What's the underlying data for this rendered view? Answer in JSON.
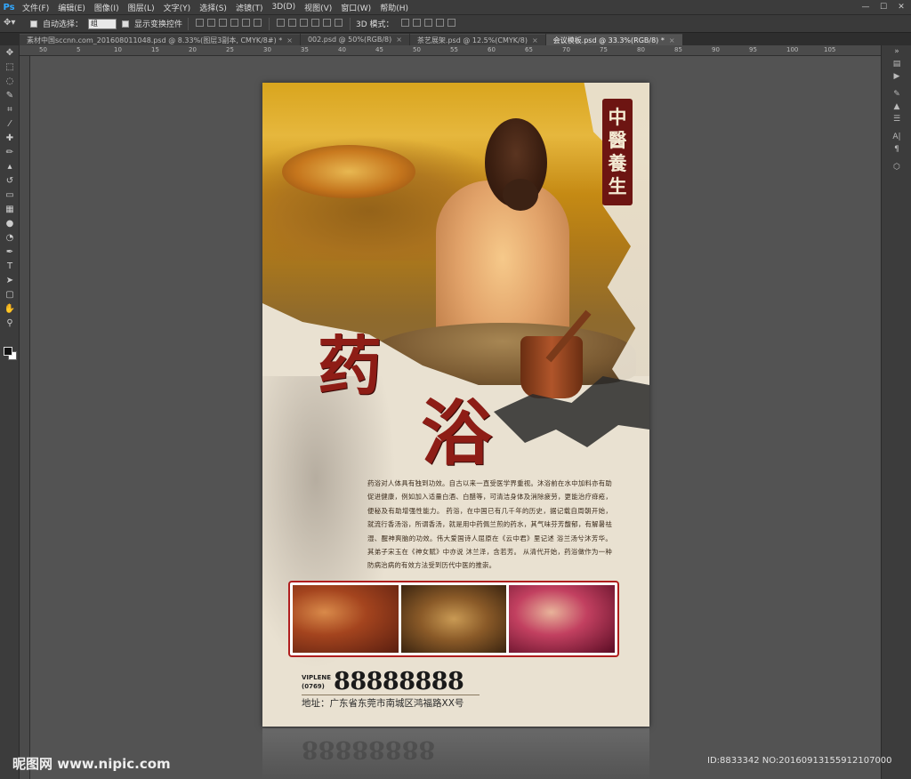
{
  "app": {
    "logo": "Ps",
    "menus": [
      "文件(F)",
      "编辑(E)",
      "图像(I)",
      "图层(L)",
      "文字(Y)",
      "选择(S)",
      "滤镜(T)",
      "3D(D)",
      "视图(V)",
      "窗口(W)",
      "帮助(H)"
    ],
    "window_controls": [
      "—",
      "☐",
      "✕"
    ]
  },
  "options_bar": {
    "auto_select_label": "自动选择：",
    "auto_select_value": "组",
    "show_transform_label": "显示变换控件",
    "mode_3d_label": "3D 模式："
  },
  "tabs": [
    {
      "label": "素材中国sccnn.com_201608011048.psd @ 8.33%(图层3副本, CMYK/8#) *",
      "active": false
    },
    {
      "label": "002.psd @ 50%(RGB/8)",
      "active": false
    },
    {
      "label": "茶艺展架.psd @ 12.5%(CMYK/8)",
      "active": false
    },
    {
      "label": "会议模板.psd @ 33.3%(RGB/8) *",
      "active": true
    }
  ],
  "ruler_labels": [
    "50",
    "5",
    "10",
    "15",
    "20",
    "25",
    "30",
    "35",
    "40",
    "45",
    "50",
    "55",
    "60",
    "65",
    "70",
    "75",
    "80",
    "85",
    "90",
    "95",
    "100",
    "105"
  ],
  "poster": {
    "seal_chars": [
      "中",
      "醫",
      "養",
      "生"
    ],
    "title_char_1": "药",
    "title_char_2": "浴",
    "body_text": "药浴对人体具有独到功效。自古以来一直受医学界重视。沐浴前在水中加料亦有助促进健康，例如加入适量白酒、白醋等，可清洁身体及消除疲劳，更能治疗痱疮，便秘及有助增强性能力。 药浴，在中国已有几千年的历史，据记载自周朝开始，就流行香汤浴，所谓香汤，就是用中药佩兰煎的药水，其气味芬芳馥郁，有解暑祛湿、醒神爽脑的功效。伟大爱国诗人屈原在《云中君》里记述 浴兰汤兮沐芳华。 其弟子宋玉在《神女赋》中亦说 沐兰泽，含若芳。 从清代开始，药浴做作为一种防病治病的有效方法受到历代中医的推崇。",
    "phone_prefix_1": "VIPLENE",
    "phone_prefix_2": "(0769)",
    "phone_number": "88888888",
    "address": "地址：广东省东莞市南城区鸿福路XX号",
    "reflection_text": "88888888"
  },
  "watermark": {
    "left": "昵图网 www.nipic.com",
    "right": "ID:8833342 NO:20160913155912107000"
  },
  "colors": {
    "accent_red": "#8e1d16",
    "seal_red": "#6d1512",
    "ps_blue": "#31a8ff"
  }
}
